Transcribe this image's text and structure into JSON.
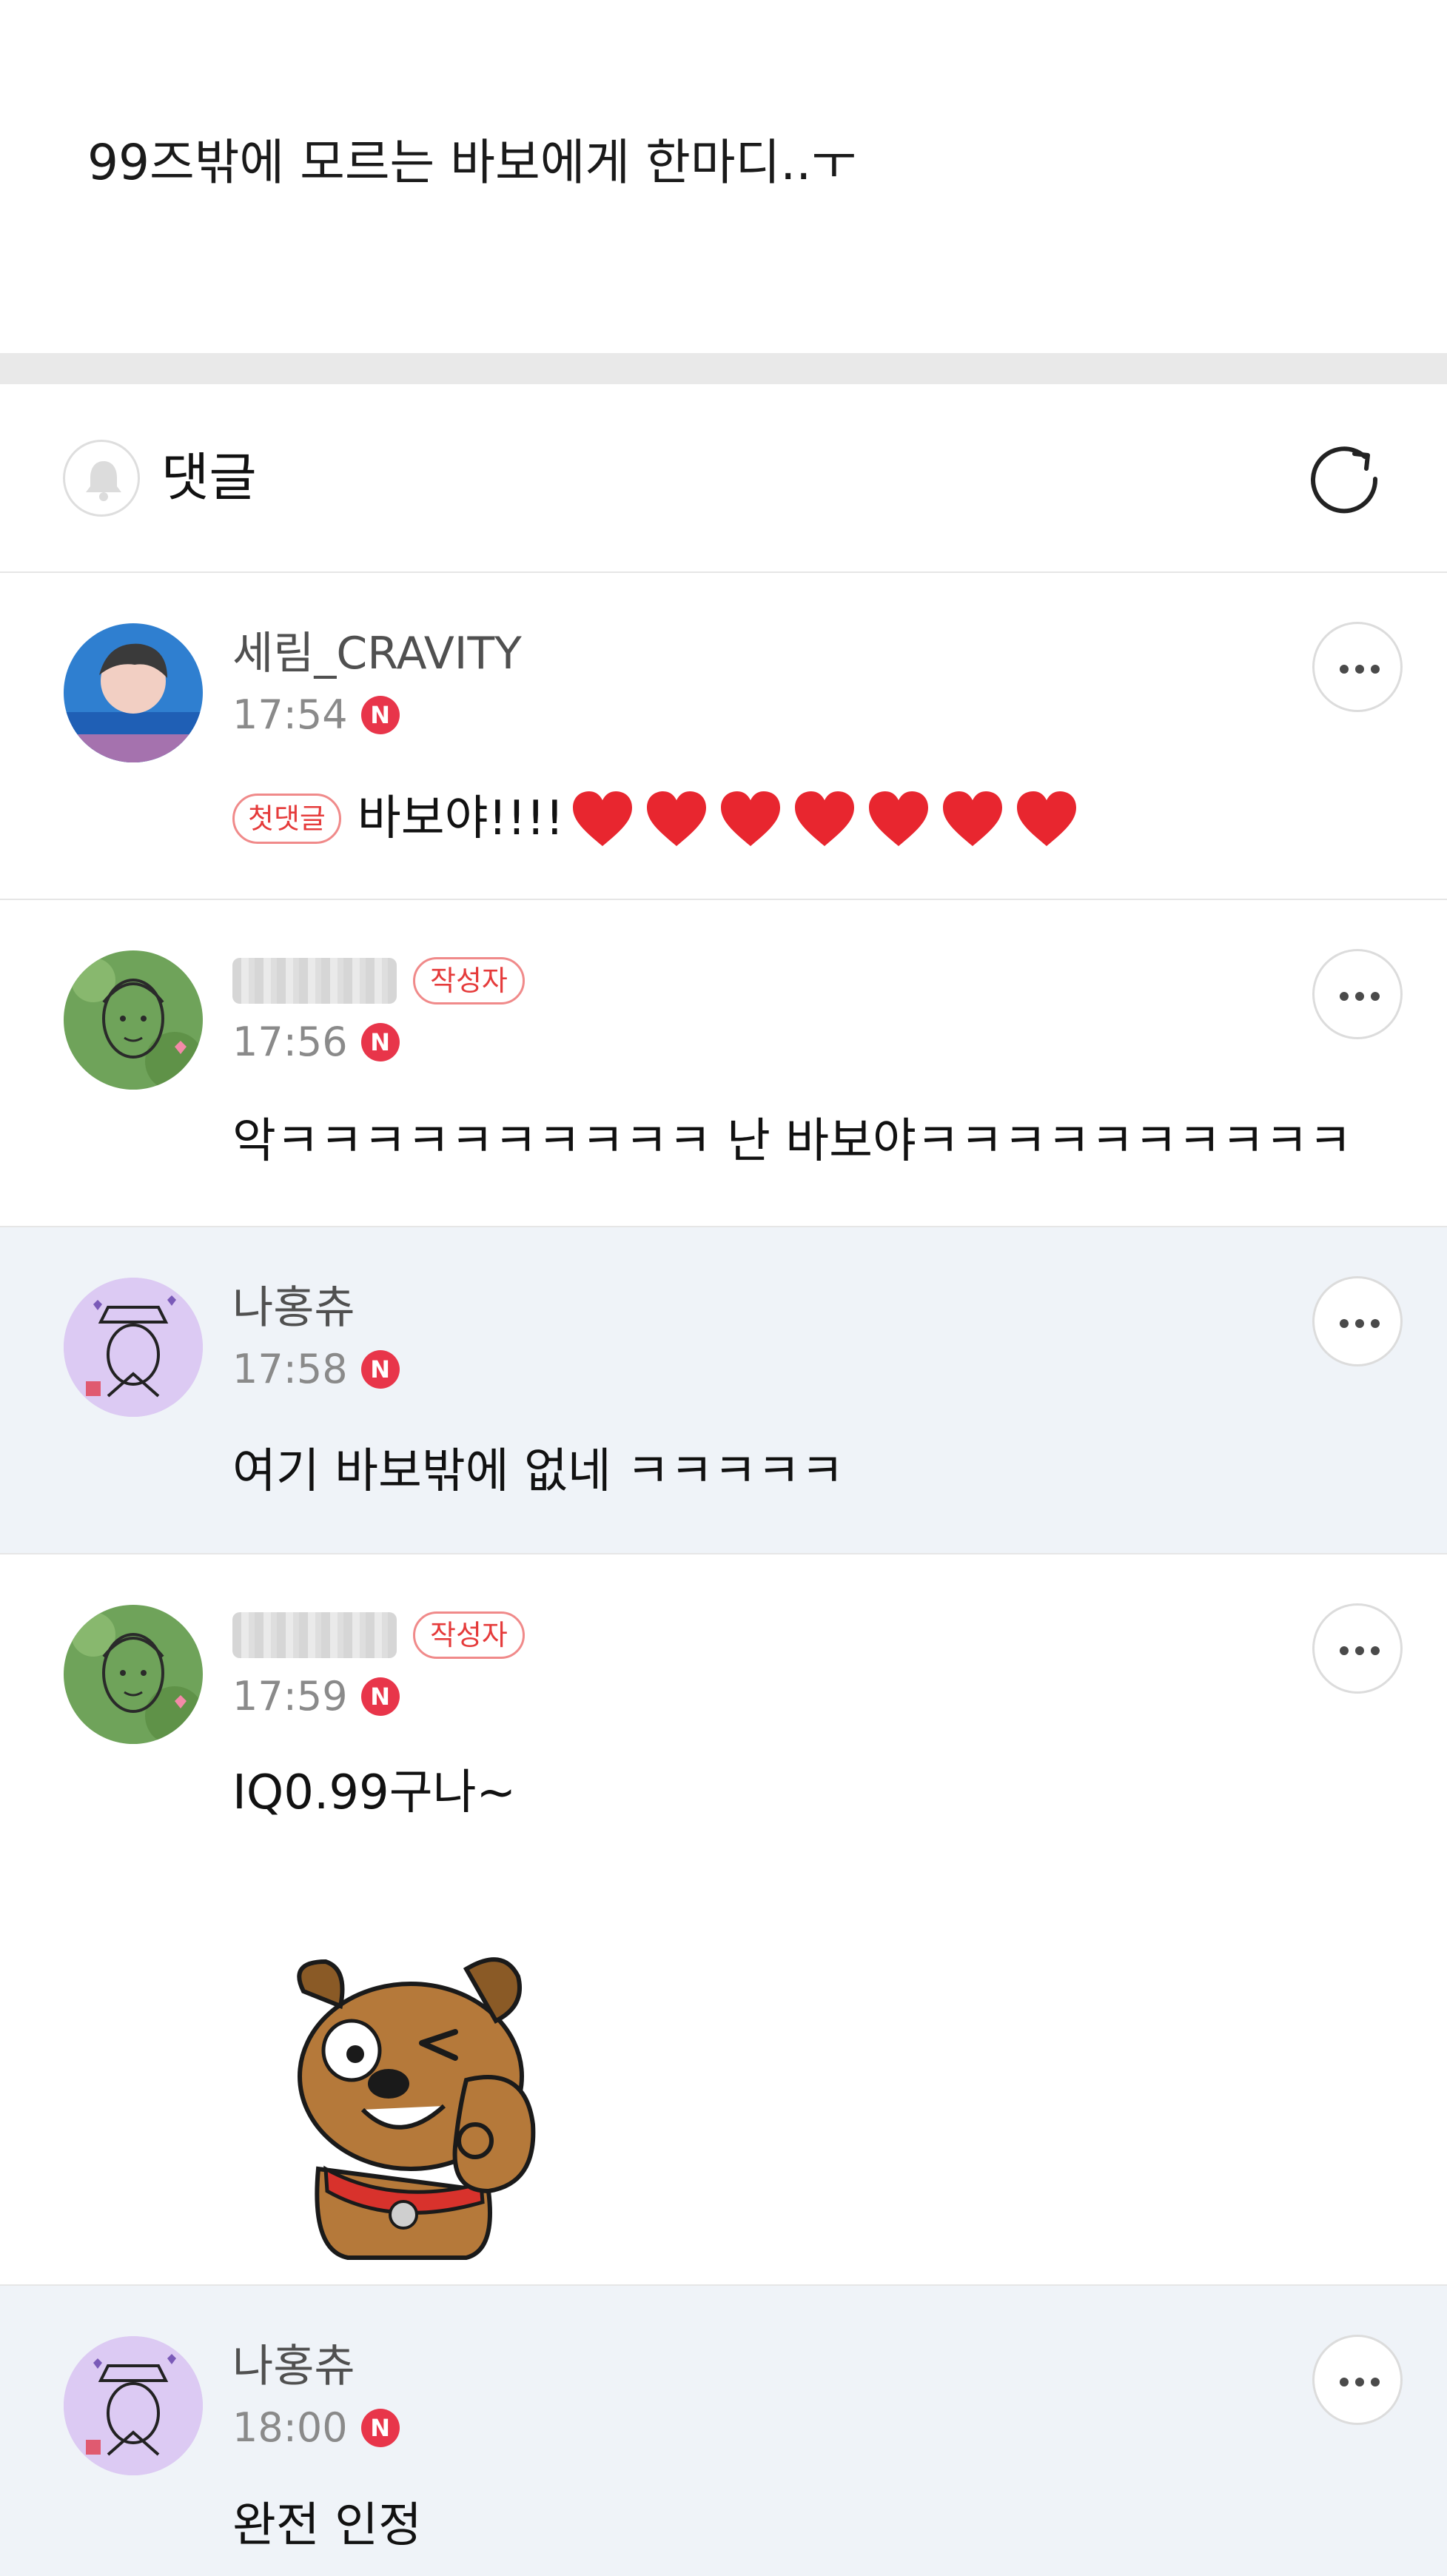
{
  "post": {
    "text": "99즈밖에 모르는 바보에게 한마디..ㅜ"
  },
  "comments_header": {
    "title": "댓글",
    "bell_icon": "bell-icon",
    "refresh_icon": "refresh-icon"
  },
  "comments": [
    {
      "author": "세림_CRAVITY",
      "time": "17:54",
      "new_badge": "N",
      "first_badge": "첫댓글",
      "text": "바보야!!!!",
      "heart_count": 7,
      "highlight": false
    },
    {
      "author": "",
      "author_blurred": true,
      "author_badge": "작성자",
      "time": "17:56",
      "new_badge": "N",
      "text": "악ㅋㅋㅋㅋㅋㅋㅋㅋㅋㅋ 난 바보야ㅋㅋㅋㅋㅋㅋㅋㅋㅋㅋ",
      "highlight": false
    },
    {
      "author": "나홍츄",
      "time": "17:58",
      "new_badge": "N",
      "text": "여기 바보밖에 없네 ㅋㅋㅋㅋㅋ",
      "highlight": true
    },
    {
      "author": "",
      "author_blurred": true,
      "author_badge": "작성자",
      "time": "17:59",
      "new_badge": "N",
      "text": "IQ0.99구나~",
      "sticker": "winking-dog-sticker",
      "highlight": false
    },
    {
      "author": "나홍츄",
      "time": "18:00",
      "new_badge": "N",
      "text": "완전 인정",
      "highlight": true
    }
  ],
  "colors": {
    "badge_red": "#e8354a",
    "badge_outline": "#f08a8a",
    "highlight_bg": "#eff3f8",
    "divider": "#e9e9e9"
  }
}
